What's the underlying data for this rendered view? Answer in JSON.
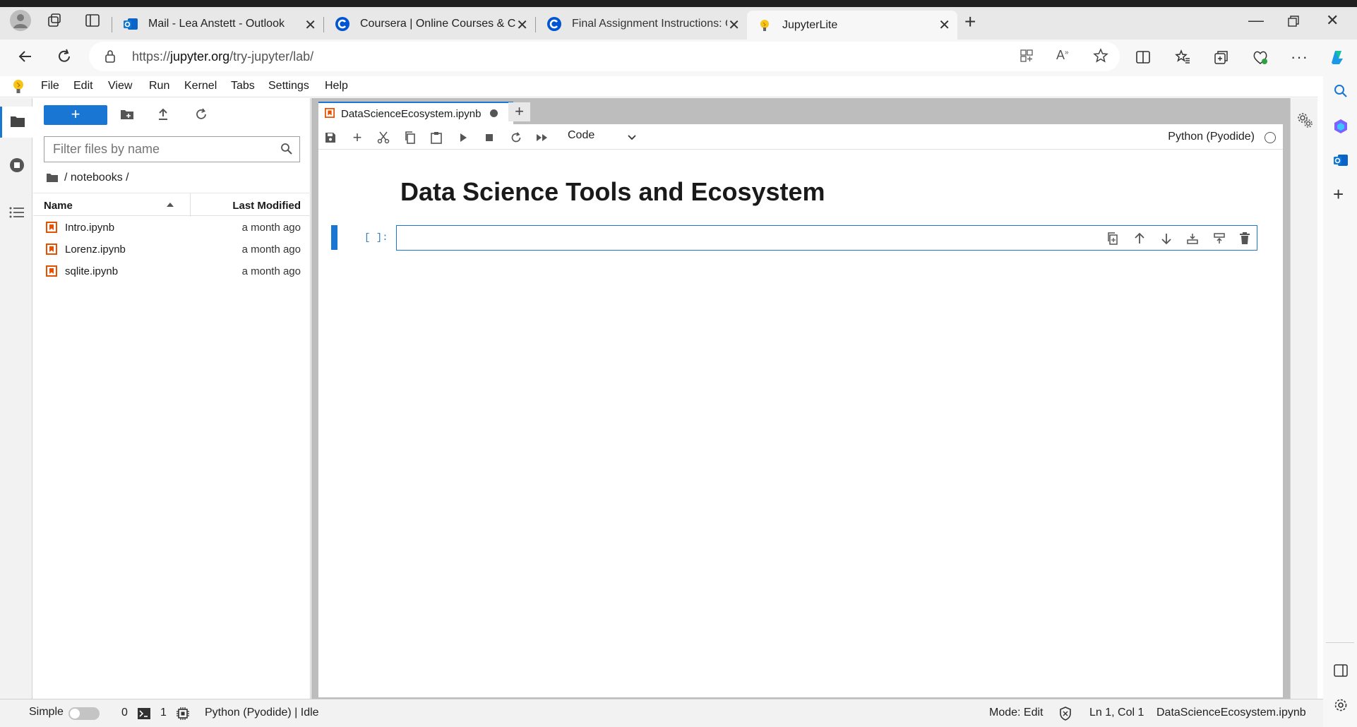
{
  "browser": {
    "tabs": [
      {
        "title": "Mail - Lea Anstett - Outlook",
        "icon": "outlook-icon"
      },
      {
        "title": "Coursera | Online Courses & Credentials",
        "icon": "coursera-icon"
      },
      {
        "title": "Final Assignment Instructions: Create",
        "icon": "coursera-icon"
      },
      {
        "title": "JupyterLite",
        "icon": "jupyter-icon"
      }
    ],
    "url_prefix": "https://",
    "url_host": "jupyter.org",
    "url_path": "/try-jupyter/lab/"
  },
  "menu": [
    "File",
    "Edit",
    "View",
    "Run",
    "Kernel",
    "Tabs",
    "Settings",
    "Help"
  ],
  "filebrowser": {
    "new_label": "+",
    "filter_placeholder": "Filter files by name",
    "breadcrumb": "/ notebooks /",
    "col_name": "Name",
    "col_modified": "Last Modified",
    "files": [
      {
        "name": "Intro.ipynb",
        "modified": "a month ago"
      },
      {
        "name": "Lorenz.ipynb",
        "modified": "a month ago"
      },
      {
        "name": "sqlite.ipynb",
        "modified": "a month ago"
      }
    ]
  },
  "notebook": {
    "tab_title": "DataScienceEcosystem.ipynb",
    "cell_type": "Code",
    "kernel": "Python (Pyodide)",
    "heading": "Data Science Tools and Ecosystem",
    "prompt": "[ ]:"
  },
  "status": {
    "simple_label": "Simple",
    "terminals": "0",
    "kernels": "1",
    "kernel_status": "Python (Pyodide) | Idle",
    "mode": "Mode: Edit",
    "position": "Ln 1, Col 1",
    "filename": "DataScienceEcosystem.ipynb"
  },
  "colors": {
    "accent": "#1976d2",
    "notebook_icon": "#e65100"
  }
}
